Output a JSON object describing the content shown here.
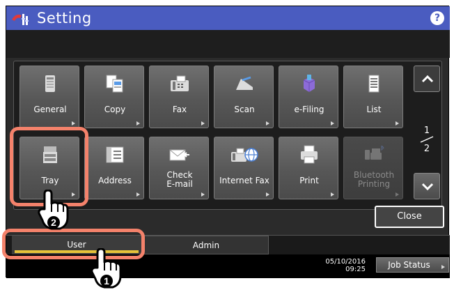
{
  "header": {
    "title": "Setting",
    "help_label": "?"
  },
  "tiles": [
    {
      "label": "General",
      "icon": "general-icon"
    },
    {
      "label": "Copy",
      "icon": "copy-icon"
    },
    {
      "label": "Fax",
      "icon": "fax-icon"
    },
    {
      "label": "Scan",
      "icon": "scan-icon"
    },
    {
      "label": "e-Filing",
      "icon": "e-filing-icon"
    },
    {
      "label": "List",
      "icon": "list-icon"
    },
    {
      "label": "Tray",
      "icon": "tray-icon"
    },
    {
      "label": "Address",
      "icon": "address-icon"
    },
    {
      "label": "Check E-mail",
      "icon": "check-email-icon"
    },
    {
      "label": "Internet Fax",
      "icon": "internet-fax-icon"
    },
    {
      "label": "Print",
      "icon": "print-icon"
    },
    {
      "label": "Bluetooth Printing",
      "icon": "bluetooth-printing-icon",
      "disabled": true
    }
  ],
  "pager": {
    "current": "1",
    "total": "2"
  },
  "close_label": "Close",
  "tabs": {
    "user": "User",
    "admin": "Admin"
  },
  "status": {
    "date": "05/10/2016",
    "time": "09:25",
    "job_status": "Job Status"
  },
  "callouts": {
    "step1": "1",
    "step2": "2"
  },
  "colors": {
    "title_bar": "#4a5cc0",
    "highlight": "#f4826b",
    "user_tab_accent": "#e6c43a"
  }
}
